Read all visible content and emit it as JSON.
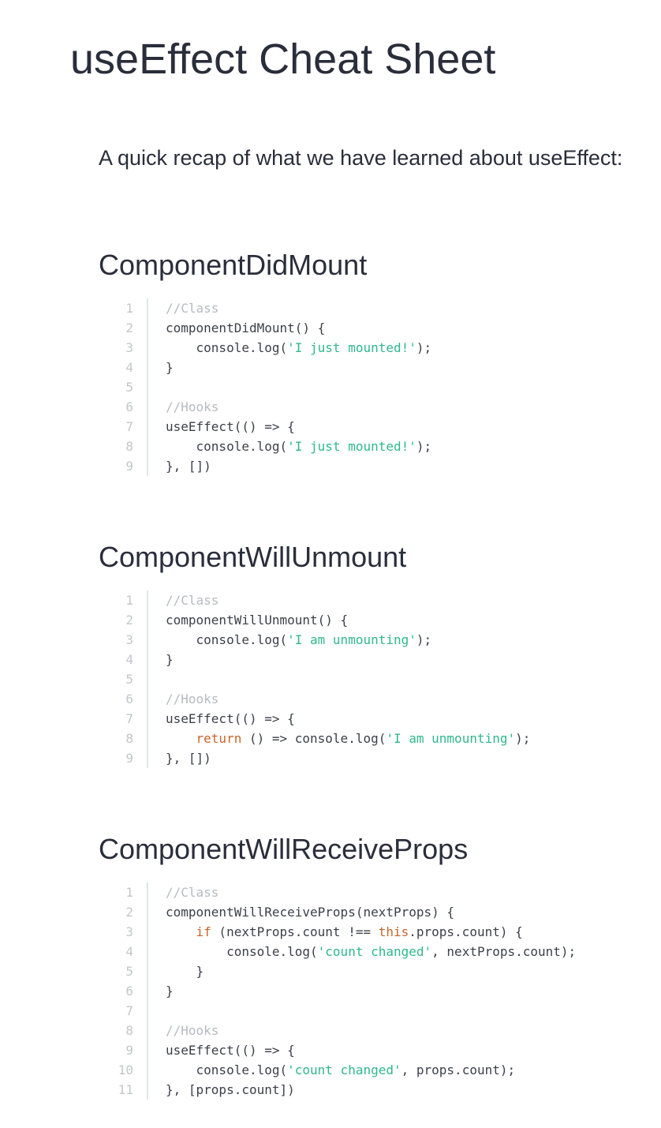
{
  "title": "useEffect Cheat Sheet",
  "intro": "A quick recap of what we have learned about useEffect:",
  "colors": {
    "comment": "#b6bac1",
    "string": "#2fb88a",
    "keyword": "#c8652a",
    "text": "#2a2e3b"
  },
  "sections": [
    {
      "heading": "ComponentDidMount",
      "lines": [
        [
          {
            "t": "//Class",
            "c": "comment"
          }
        ],
        [
          {
            "t": "componentDidMount() {"
          }
        ],
        [
          {
            "t": "    console.log("
          },
          {
            "t": "'I just mounted!'",
            "c": "string"
          },
          {
            "t": ");"
          }
        ],
        [
          {
            "t": "}"
          }
        ],
        [],
        [
          {
            "t": "//Hooks",
            "c": "comment"
          }
        ],
        [
          {
            "t": "useEffect(() => {"
          }
        ],
        [
          {
            "t": "    console.log("
          },
          {
            "t": "'I just mounted!'",
            "c": "string"
          },
          {
            "t": ");"
          }
        ],
        [
          {
            "t": "}, [])"
          }
        ]
      ]
    },
    {
      "heading": "ComponentWillUnmount",
      "lines": [
        [
          {
            "t": "//Class",
            "c": "comment"
          }
        ],
        [
          {
            "t": "componentWillUnmount() {"
          }
        ],
        [
          {
            "t": "    console.log("
          },
          {
            "t": "'I am unmounting'",
            "c": "string"
          },
          {
            "t": ");"
          }
        ],
        [
          {
            "t": "}"
          }
        ],
        [],
        [
          {
            "t": "//Hooks",
            "c": "comment"
          }
        ],
        [
          {
            "t": "useEffect(() => {"
          }
        ],
        [
          {
            "t": "    "
          },
          {
            "t": "return",
            "c": "keyword"
          },
          {
            "t": " () => console.log("
          },
          {
            "t": "'I am unmounting'",
            "c": "string"
          },
          {
            "t": ");"
          }
        ],
        [
          {
            "t": "}, [])"
          }
        ]
      ]
    },
    {
      "heading": "ComponentWillReceiveProps",
      "lines": [
        [
          {
            "t": "//Class",
            "c": "comment"
          }
        ],
        [
          {
            "t": "componentWillReceiveProps(nextProps) {"
          }
        ],
        [
          {
            "t": "    "
          },
          {
            "t": "if",
            "c": "keyword"
          },
          {
            "t": " (nextProps.count !== "
          },
          {
            "t": "this",
            "c": "keyword"
          },
          {
            "t": ".props.count) {"
          }
        ],
        [
          {
            "t": "        console.log("
          },
          {
            "t": "'count changed'",
            "c": "string"
          },
          {
            "t": ", nextProps.count);"
          }
        ],
        [
          {
            "t": "    }"
          }
        ],
        [
          {
            "t": "}"
          }
        ],
        [],
        [
          {
            "t": "//Hooks",
            "c": "comment"
          }
        ],
        [
          {
            "t": "useEffect(() => {"
          }
        ],
        [
          {
            "t": "    console.log("
          },
          {
            "t": "'count changed'",
            "c": "string"
          },
          {
            "t": ", props.count);"
          }
        ],
        [
          {
            "t": "}, [props.count])"
          }
        ]
      ]
    }
  ]
}
